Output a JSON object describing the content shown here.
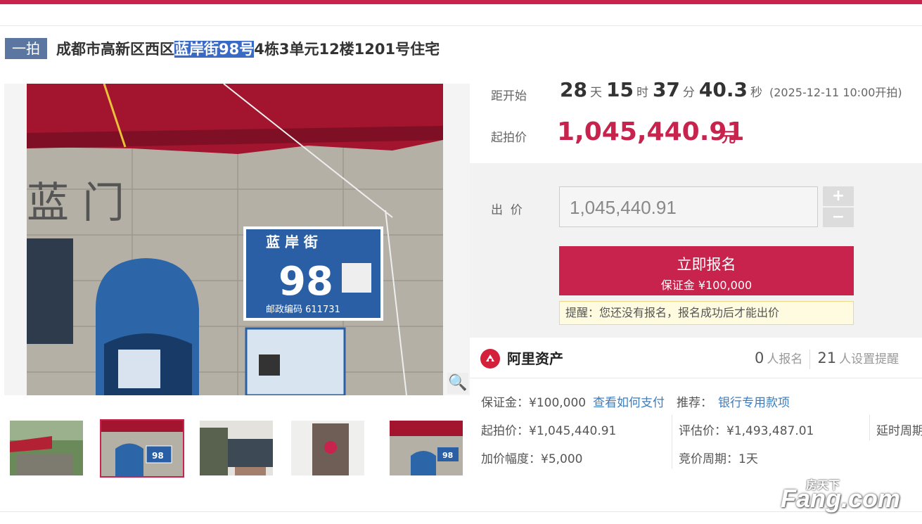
{
  "header": {
    "tag": "一拍",
    "title_prefix": "成都市高新区西区",
    "title_highlight": "蓝岸街98号",
    "title_suffix": "4栋3单元12楼1201号住宅"
  },
  "gallery": {
    "zoom_icon": "magnifier-icon",
    "thumbnail_count": 5,
    "selected_index": 1
  },
  "countdown": {
    "label": "距开始",
    "days": "28",
    "days_unit": "天",
    "hours": "15",
    "hours_unit": "时",
    "minutes": "37",
    "minutes_unit": "分",
    "seconds": "40.3",
    "seconds_unit": "秒",
    "start_time": "(2025-12-11 10:00开拍)"
  },
  "start_price": {
    "label": "起拍价",
    "value": "1,045,440.91",
    "unit": "元"
  },
  "bid": {
    "label": "出  价",
    "value": "1,045,440.91",
    "plus": "+",
    "minus": "−",
    "signup_label": "立即报名",
    "deposit_label": "保证金 ¥100,000",
    "notice": "提醒：您还没有报名，报名成功后才能出价"
  },
  "platform": {
    "name": "阿里资产",
    "signups": "0",
    "signups_label": "人报名",
    "reminders": "21",
    "reminders_label": "人设置提醒"
  },
  "details": {
    "deposit": "保证金：¥100,000",
    "how_to_pay": "查看如何支付",
    "recommend_label": "推荐：",
    "recommend_link": "银行专用款项",
    "start_price": "起拍价：¥1,045,440.91",
    "appraisal": "评估价：¥1,493,487.01",
    "delay": "延时周期",
    "increment": "加价幅度：¥5,000",
    "period": "竞价周期：1天"
  },
  "watermark": {
    "text_small": "房天下",
    "text_big": "Fang.com"
  },
  "colors": {
    "accent": "#c8234c",
    "tag_bg": "#5b76a1",
    "link": "#3c7dc2",
    "highlight": "#3b6ac6"
  }
}
